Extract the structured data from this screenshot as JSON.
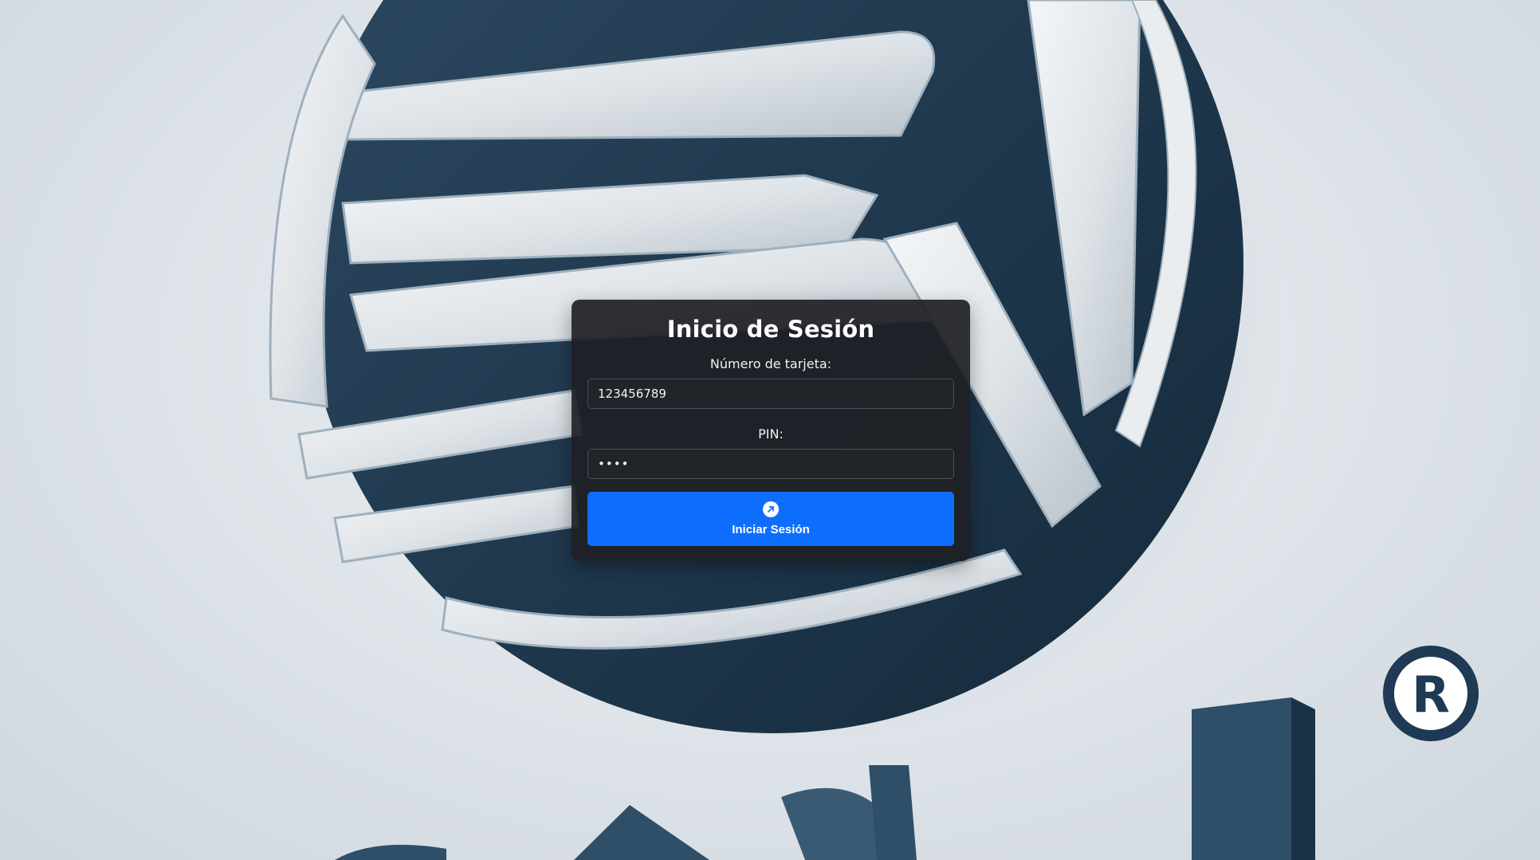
{
  "background": {
    "logo_name": "rg-logo-3d-background"
  },
  "login": {
    "title": "Inicio de Sesión",
    "card_number_label": "Número de tarjeta:",
    "card_number_value": "123456789",
    "pin_label": "PIN:",
    "pin_value": "1234",
    "submit_label": "Iniciar Sesión",
    "submit_icon": "arrow-up-right-circle-icon",
    "accent_color": "#0d6efd"
  }
}
